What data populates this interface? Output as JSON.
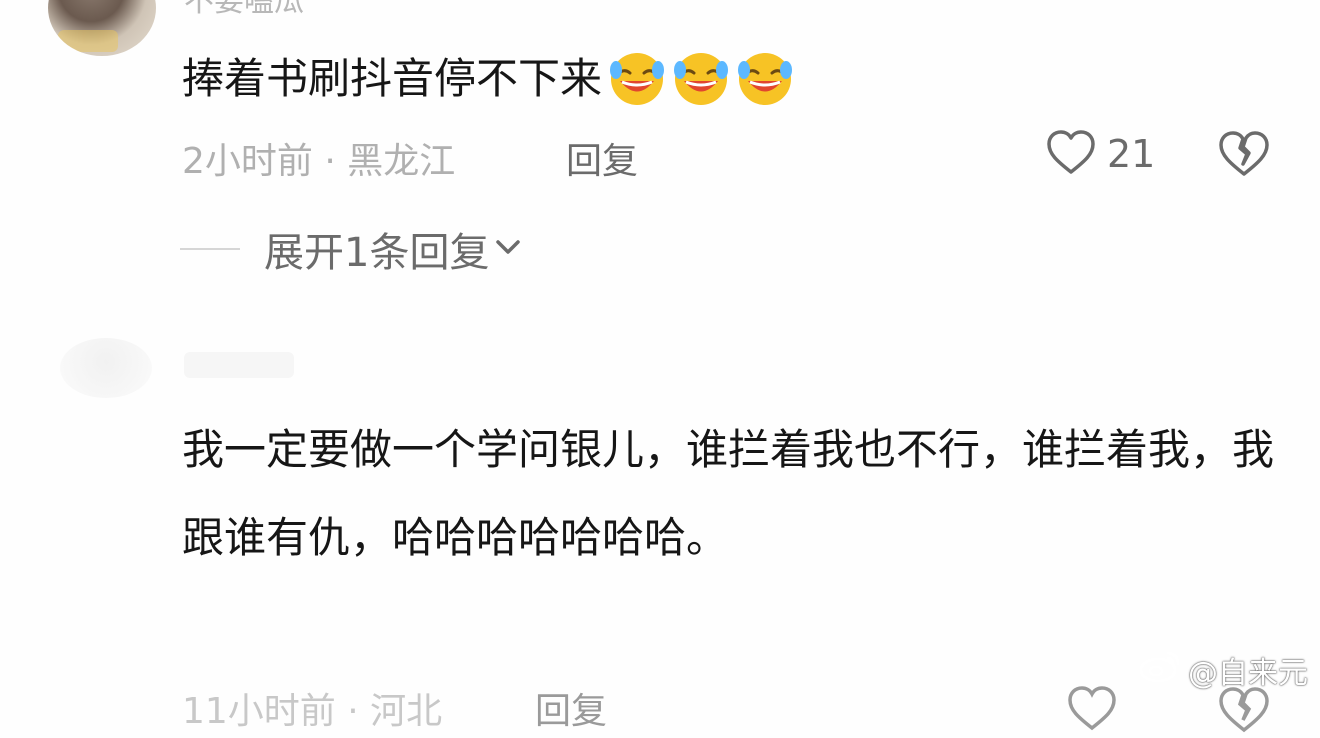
{
  "comment1": {
    "username_partial": "不要嗑瓜",
    "text": "捧着书刷抖音停不下来",
    "emojis": [
      "laughing-crying-emoji",
      "laughing-crying-emoji",
      "laughing-crying-emoji"
    ],
    "meta": "2小时前 · 黑龙江",
    "reply_label": "回复",
    "like_count": "21",
    "expand_replies_label": "展开1条回复"
  },
  "comment2": {
    "text": "我一定要做一个学问银儿，谁拦着我也不行，谁拦着我，我跟谁有仇，哈哈哈哈哈哈哈。",
    "meta_partial": "11小时前 · 河北",
    "reply_label": "回复"
  },
  "watermark": {
    "text": "@自来元",
    "icon": "weibo-icon"
  },
  "colors": {
    "primary_text": "#161616",
    "secondary_text": "#6b6b6b",
    "meta_text": "#b0b0b0",
    "emoji_yellow": "#f7c325",
    "emoji_mouth": "#e1462e"
  }
}
